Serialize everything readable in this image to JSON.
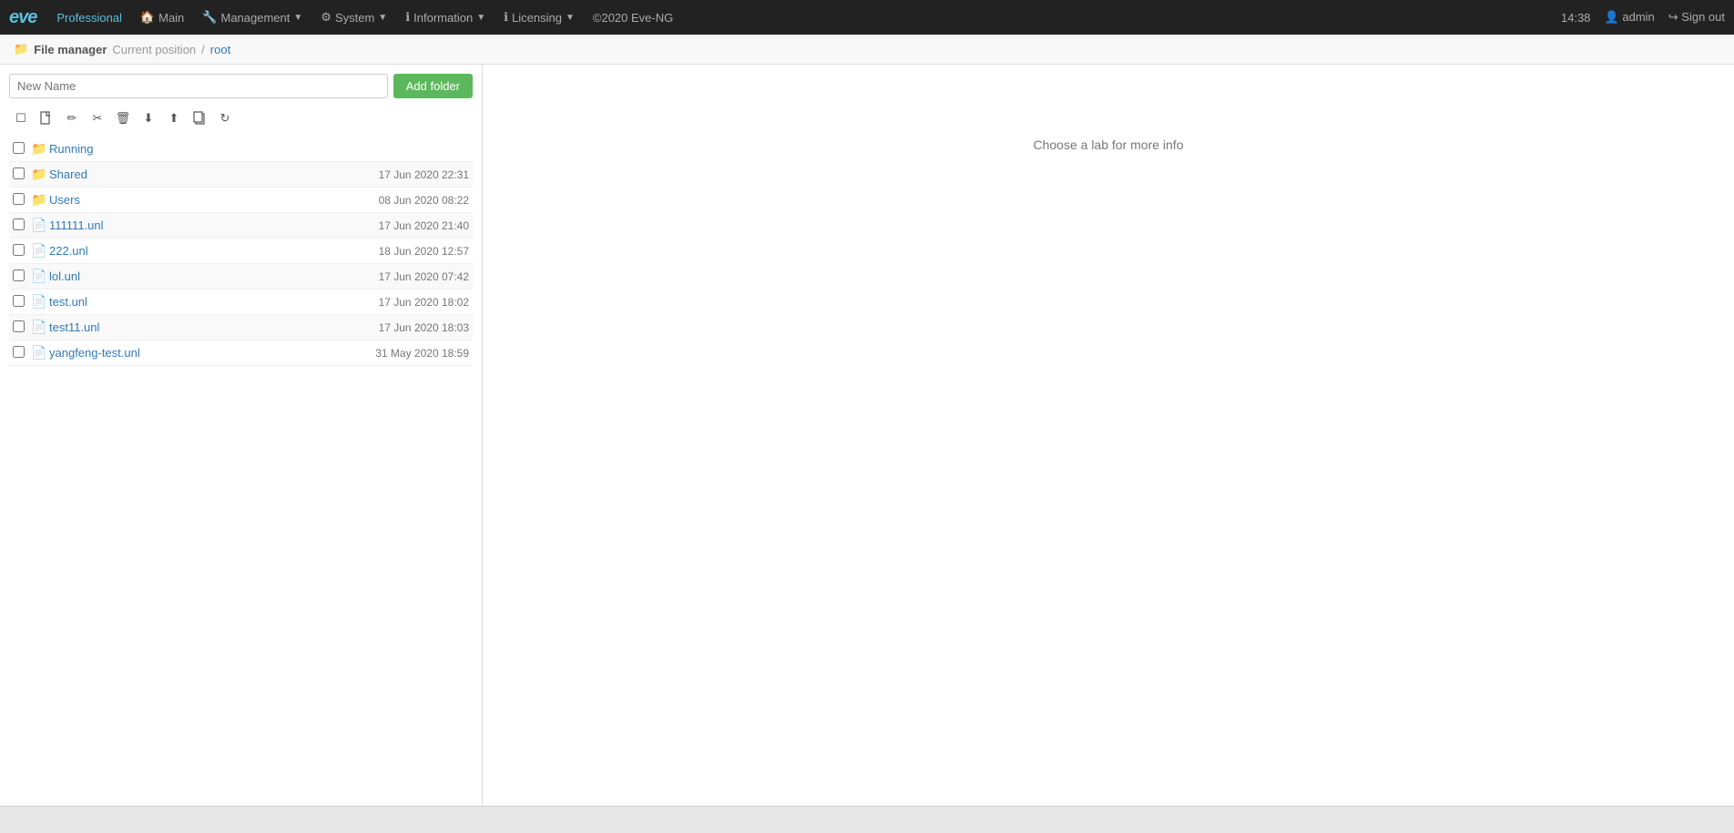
{
  "navbar": {
    "logo": "eve",
    "items": [
      {
        "label": "Professional",
        "active": true,
        "has_caret": false,
        "icon": ""
      },
      {
        "label": "Main",
        "active": false,
        "has_caret": false,
        "icon": "🏠"
      },
      {
        "label": "Management",
        "active": false,
        "has_caret": true,
        "icon": "🔧"
      },
      {
        "label": "System",
        "active": false,
        "has_caret": true,
        "icon": "⚙"
      },
      {
        "label": "Information",
        "active": false,
        "has_caret": true,
        "icon": "ℹ"
      },
      {
        "label": "Licensing",
        "active": false,
        "has_caret": true,
        "icon": "ℹ"
      },
      {
        "label": "©2020 Eve-NG",
        "active": false,
        "has_caret": false,
        "icon": ""
      }
    ],
    "time": "14:38",
    "user": "admin",
    "signout": "Sign out"
  },
  "breadcrumb": {
    "icon": "📁",
    "label": "File manager",
    "current_position": "Current position",
    "separator": "/",
    "path": "root"
  },
  "toolbar": {
    "add_folder_placeholder": "New Name",
    "add_folder_btn": "Add folder",
    "icons": [
      {
        "name": "select-all-icon",
        "symbol": "☐"
      },
      {
        "name": "new-file-icon",
        "symbol": "📄"
      },
      {
        "name": "edit-icon",
        "symbol": "✏"
      },
      {
        "name": "cut-icon",
        "symbol": "✂"
      },
      {
        "name": "delete-icon",
        "symbol": "🗑"
      },
      {
        "name": "download-icon",
        "symbol": "⬇"
      },
      {
        "name": "upload-icon",
        "symbol": "⬆"
      },
      {
        "name": "copy-icon",
        "symbol": "📋"
      },
      {
        "name": "refresh-icon",
        "symbol": "↻"
      }
    ]
  },
  "files": [
    {
      "type": "folder",
      "name": "Running",
      "date": ""
    },
    {
      "type": "folder",
      "name": "Shared",
      "date": "17 Jun 2020 22:31"
    },
    {
      "type": "folder",
      "name": "Users",
      "date": "08 Jun 2020 08:22"
    },
    {
      "type": "file",
      "name": "111111.unl",
      "date": "17 Jun 2020 21:40"
    },
    {
      "type": "file",
      "name": "222.unl",
      "date": "18 Jun 2020 12:57"
    },
    {
      "type": "file",
      "name": "lol.unl",
      "date": "17 Jun 2020 07:42"
    },
    {
      "type": "file",
      "name": "test.unl",
      "date": "17 Jun 2020 18:02"
    },
    {
      "type": "file",
      "name": "test11.unl",
      "date": "17 Jun 2020 18:03"
    },
    {
      "type": "file",
      "name": "yangfeng-test.unl",
      "date": "31 May 2020 18:59"
    }
  ],
  "right_panel": {
    "placeholder": "Choose a lab for more info"
  }
}
